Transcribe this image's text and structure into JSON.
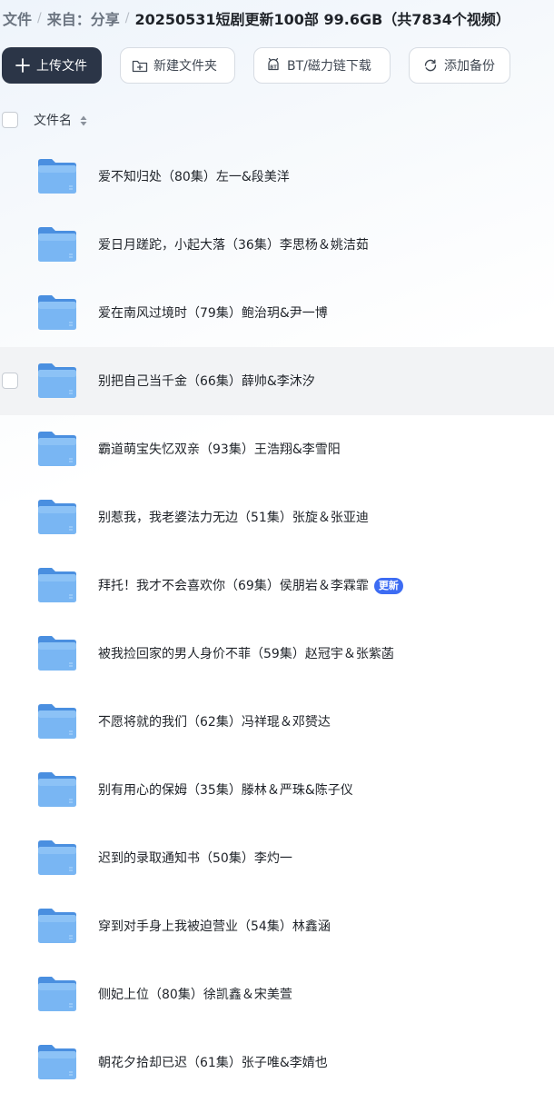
{
  "breadcrumb": {
    "root": "文件",
    "from": "来自：分享",
    "current": "20250531短剧更新100部 99.6GB（共7834个视频）",
    "separator": "/"
  },
  "toolbar": {
    "upload": "上传文件",
    "new_folder": "新建文件夹",
    "bt_download": "BT/磁力链下载",
    "add_backup": "添加备份"
  },
  "list_header": {
    "name_label": "文件名"
  },
  "files": [
    {
      "name": "爱不知归处（80集）左一&段美洋"
    },
    {
      "name": "爱日月蹉跎，小起大落（36集）李思杨＆姚洁茹"
    },
    {
      "name": "爱在南风过境时（79集）鲍治玥&尹一博"
    },
    {
      "name": "别把自己当千金（66集）薛帅&李沐汐"
    },
    {
      "name": "霸道萌宝失忆双亲（93集）王浩翔&李雪阳"
    },
    {
      "name": "别惹我，我老婆法力无边（51集）张旋＆张亚迪"
    },
    {
      "name": "拜托！我才不会喜欢你（69集）侯朋岩＆李霖霏",
      "badge": "更新"
    },
    {
      "name": "被我捡回家的男人身价不菲（59集）赵冠宇＆张紫菡"
    },
    {
      "name": "不愿将就的我们（62集）冯祥琨＆邓赟达"
    },
    {
      "name": "别有用心的保姆（35集）滕林＆严珠&陈子仪"
    },
    {
      "name": "迟到的录取通知书（50集）李灼一"
    },
    {
      "name": "穿到对手身上我被迫营业（54集）林鑫涵"
    },
    {
      "name": "侧妃上位（80集）徐凯鑫＆宋美萱"
    },
    {
      "name": "朝花夕拾却已迟（61集）张子唯&李婧也"
    }
  ],
  "hovered_index": 3,
  "colors": {
    "primary_button": "#2b3547",
    "badge": "#3d6cf3",
    "folder": "#6aaef0"
  },
  "icons": {
    "upload": "plus-icon",
    "new_folder": "folder-plus-icon",
    "bt_download": "bt-icon",
    "add_backup": "sync-icon",
    "sort": "sort-icon",
    "file": "folder-icon"
  }
}
